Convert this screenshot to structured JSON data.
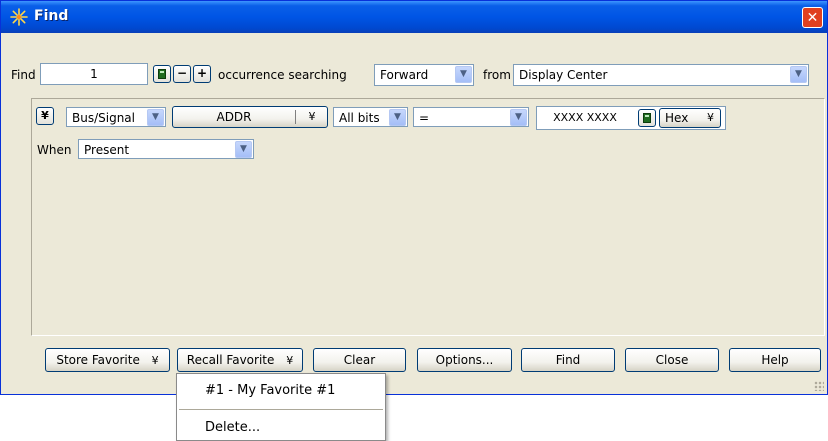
{
  "window": {
    "title": "Find",
    "close_label": "✕"
  },
  "find_row": {
    "find_label": "Find",
    "occurrence_value": "1",
    "minus_label": "−",
    "plus_label": "+",
    "occurrence_label": "occurrence searching",
    "direction": "Forward",
    "from_label": "from",
    "from_value": "Display Center"
  },
  "criteria": {
    "expand_label": "¥",
    "type_value": "Bus/Signal",
    "bus_value": "ADDR",
    "bus_dropdown_label": "¥",
    "bits_value": "All bits",
    "operator_value": "=",
    "pattern_value": "XXXX XXXX",
    "radix_value": "Hex",
    "radix_dropdown_label": "¥",
    "when_label": "When",
    "when_value": "Present"
  },
  "buttons": {
    "store_favorite": "Store Favorite",
    "recall_favorite": "Recall Favorite",
    "dropdown_glyph": "¥",
    "clear": "Clear",
    "options": "Options...",
    "find": "Find",
    "close": "Close",
    "help": "Help"
  },
  "recall_menu": {
    "items": [
      "#1 - My Favorite #1",
      "Delete..."
    ]
  }
}
